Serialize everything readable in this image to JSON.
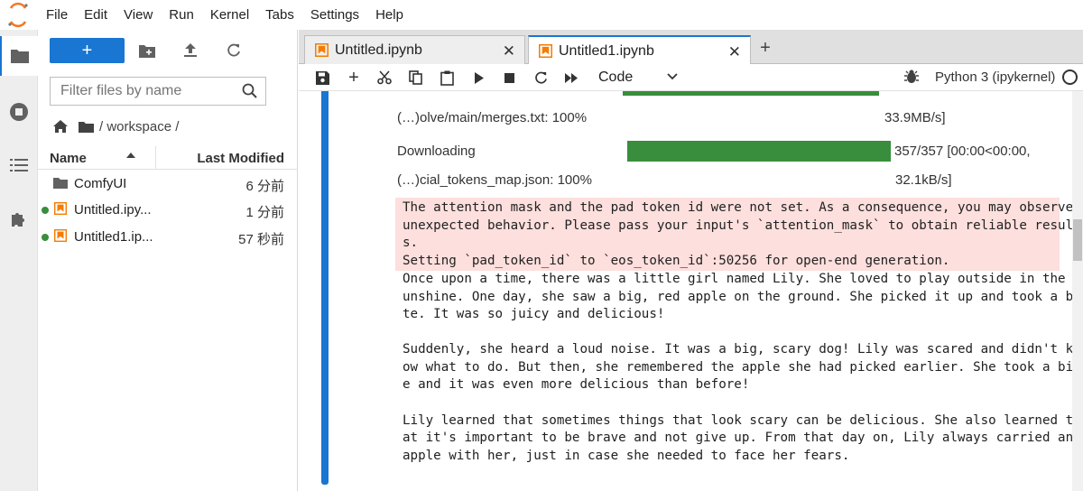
{
  "menubar": {
    "items": [
      "File",
      "Edit",
      "View",
      "Run",
      "Kernel",
      "Tabs",
      "Settings",
      "Help"
    ]
  },
  "filebrowser": {
    "new_label": "+",
    "filter_placeholder": "Filter files by name",
    "breadcrumb": "/ workspace /",
    "columns": {
      "name": "Name",
      "modified": "Last Modified"
    },
    "files": [
      {
        "name": "ComfyUI",
        "modified": "6 分前",
        "type": "folder",
        "running": false
      },
      {
        "name": "Untitled.ipy...",
        "modified": "1 分前",
        "type": "notebook",
        "running": true
      },
      {
        "name": "Untitled1.ip...",
        "modified": "57 秒前",
        "type": "notebook",
        "running": true
      }
    ]
  },
  "tabs": [
    {
      "label": "Untitled.ipynb",
      "active": false
    },
    {
      "label": "Untitled1.ipynb",
      "active": true
    }
  ],
  "toolbar": {
    "cell_type": "Code",
    "kernel": "Python 3 (ipykernel)"
  },
  "output": {
    "progress": [
      {
        "label": "Downloading",
        "fraction": 1.0,
        "stats": ""
      },
      {
        "label": "(…)olve/main/merges.txt: 100%",
        "fraction": null,
        "stats": "33.9MB/s]"
      },
      {
        "label": "Downloading",
        "fraction": 1.0,
        "stats": "357/357 [00:00<00:00,"
      },
      {
        "label": "(…)cial_tokens_map.json: 100%",
        "fraction": null,
        "stats": "32.1kB/s]"
      }
    ],
    "stderr": [
      "The attention mask and the pad token id were not set. As a consequence, you may observe",
      "unexpected behavior. Please pass your input's `attention_mask` to obtain reliable result",
      "s.",
      "Setting `pad_token_id` to `eos_token_id`:50256 for open-end generation."
    ],
    "stdout": [
      "Once upon a time, there was a little girl named Lily. She loved to play outside in the s",
      "unshine. One day, she saw a big, red apple on the ground. She picked it up and took a bi",
      "te. It was so juicy and delicious!",
      "",
      "Suddenly, she heard a loud noise. It was a big, scary dog! Lily was scared and didn't kn",
      "ow what to do. But then, she remembered the apple she had picked earlier. She took a bit",
      "e and it was even more delicious than before!",
      "",
      "Lily learned that sometimes things that look scary can be delicious. She also learned th",
      "at it's important to be brave and not give up. From that day on, Lily always carried an",
      "apple with her, just in case she needed to face her fears."
    ]
  },
  "colors": {
    "accent": "#1976d2",
    "progress": "#388e3c",
    "stderr_bg": "#fddfdd",
    "notebook_icon": "#f57c00"
  }
}
